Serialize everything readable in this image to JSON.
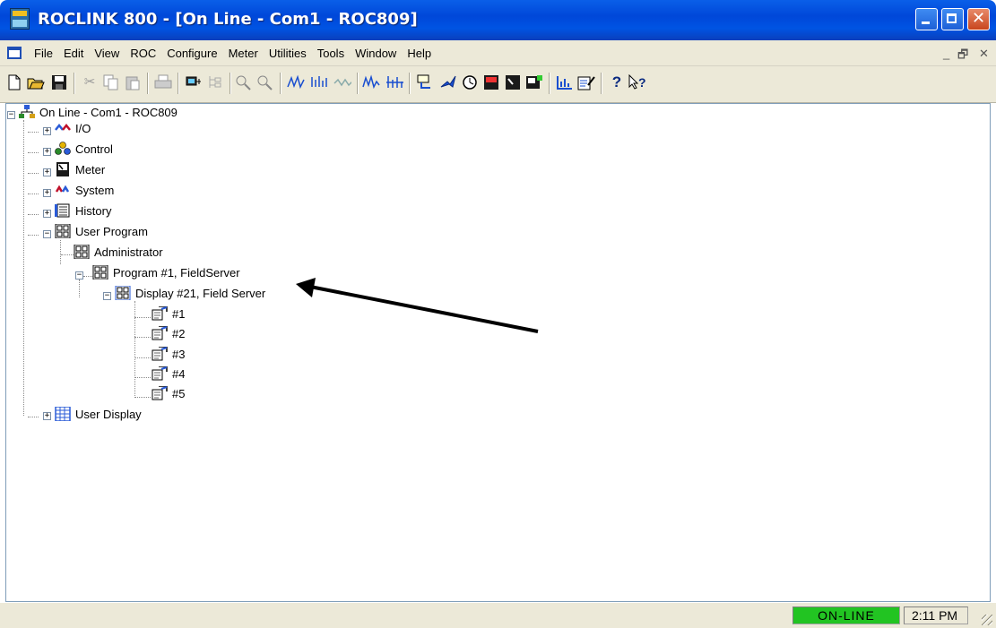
{
  "window": {
    "title": "ROCLINK 800 - [On Line - Com1 - ROC809]",
    "close_glyph": "✕"
  },
  "menu": {
    "items": [
      {
        "label": "File"
      },
      {
        "label": "Edit"
      },
      {
        "label": "View"
      },
      {
        "label": "ROC"
      },
      {
        "label": "Configure"
      },
      {
        "label": "Meter"
      },
      {
        "label": "Utilities"
      },
      {
        "label": "Tools"
      },
      {
        "label": "Window"
      },
      {
        "label": "Help"
      }
    ],
    "mdi_min": "_",
    "mdi_restore": "🗗",
    "mdi_close": "✕"
  },
  "toolbar": {
    "icons": [
      "new-icon",
      "open-icon",
      "save-icon",
      "cut-icon",
      "copy-icon",
      "paste-icon",
      "print-icon",
      "connect-icon",
      "tree-icon",
      "zoom-in-icon",
      "zoom-out-icon",
      "plot-icon",
      "io-plot-icon",
      "wave-icon",
      "trend-icon",
      "bar-plot-icon",
      "download-icon",
      "run-icon",
      "clock-icon",
      "meter-icon",
      "display-icon",
      "monitor-icon",
      "chart-icon",
      "edit-icon",
      "help-icon",
      "context-help-icon"
    ],
    "help_glyph": "?",
    "context_help_glyph": "?"
  },
  "tree": {
    "root": "On Line - Com1 - ROC809",
    "nodes": {
      "io": "I/O",
      "control": "Control",
      "meter": "Meter",
      "system": "System",
      "history": "History",
      "user_program": "User Program",
      "administrator": "Administrator",
      "program1": "Program #1, FieldServer",
      "display21": "Display #21, Field Server",
      "d1": "#1",
      "d2": "#2",
      "d3": "#3",
      "d4": "#4",
      "d5": "#5",
      "user_display": "User Display"
    },
    "expand_plus": "+",
    "expand_minus": "−"
  },
  "status": {
    "connection": "ON-LINE",
    "time": "2:11 PM",
    "online_color": "#22c422"
  }
}
